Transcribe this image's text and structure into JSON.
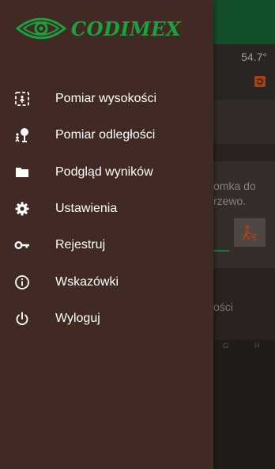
{
  "drawer": {
    "logo_text": "CODIMEX",
    "items": [
      {
        "label": "Pomiar wysokości",
        "icon": "height-measure-icon"
      },
      {
        "label": "Pomiar odległości",
        "icon": "distance-measure-icon"
      },
      {
        "label": "Podgląd wyników",
        "icon": "folder-icon"
      },
      {
        "label": "Ustawienia",
        "icon": "gear-icon"
      },
      {
        "label": "Rejestruj",
        "icon": "key-icon"
      },
      {
        "label": "Wskazówki",
        "icon": "info-icon"
      },
      {
        "label": "Wyloguj",
        "icon": "power-icon"
      }
    ]
  },
  "background": {
    "angle_readout": "54.7°",
    "hint_text": "omka do\nrzewo.",
    "distance_fragment": "ości",
    "bottom_letters": [
      "G",
      "H"
    ]
  },
  "colors": {
    "drawer_bg": "#412a24",
    "brand_green": "#19a33e",
    "toolbar_green": "#1b6e3a",
    "accent_orange": "#e85a1e"
  }
}
